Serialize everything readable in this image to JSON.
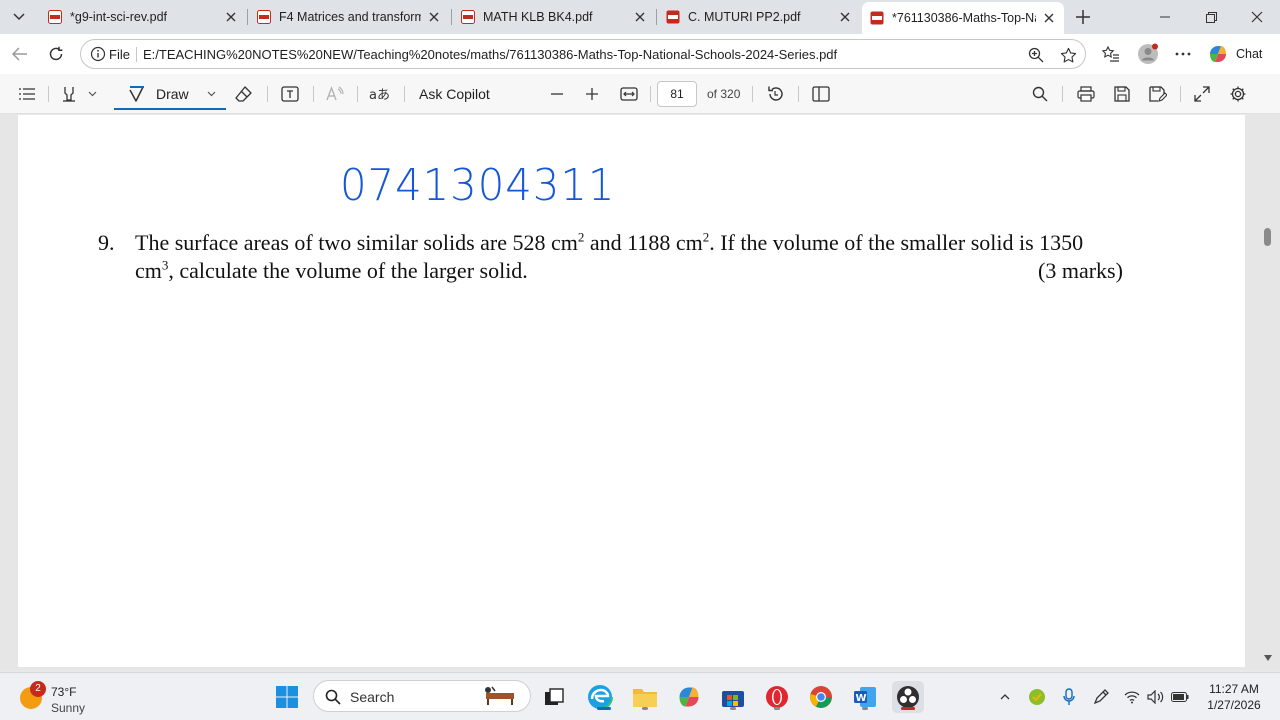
{
  "tabs": [
    {
      "title": "*g9-int-sci-rev.pdf"
    },
    {
      "title": "F4 Matrices and transforma"
    },
    {
      "title": "MATH KLB BK4.pdf"
    },
    {
      "title": "C. MUTURI PP2.pdf"
    },
    {
      "title": "*761130386-Maths-Top-Na"
    }
  ],
  "address": {
    "scheme_label": "File",
    "url": "E:/TEACHING%20NOTES%20NEW/Teaching%20notes/maths/761130386-Maths-Top-National-Schools-2024-Series.pdf"
  },
  "chat_label": "Chat",
  "pdf_toolbar": {
    "draw_label": "Draw",
    "ask_copilot_label": "Ask Copilot",
    "page_number": "81",
    "page_total": "of 320"
  },
  "document": {
    "handwritten_number": "0741304311",
    "question_number": "9.",
    "line1_a": "The surface areas of two similar solids are 528 cm",
    "sup1": "2",
    "line1_b": " and 1188 cm",
    "sup2": "2",
    "line1_c": ". If the volume of the smaller solid is 1350",
    "line2_a": "cm",
    "sup3": "3",
    "line2_b": ", calculate the volume of the larger solid.",
    "marks": "(3 marks)"
  },
  "taskbar": {
    "weather_badge": "2",
    "temperature": "73°F",
    "condition": "Sunny",
    "search_label": "Search",
    "time": "11:27 AM",
    "date": "1/27/2026"
  },
  "colors": {
    "handwriting": "#1557d6",
    "accent": "#0f6cbd",
    "pdf_icon": "#c42b1c"
  }
}
